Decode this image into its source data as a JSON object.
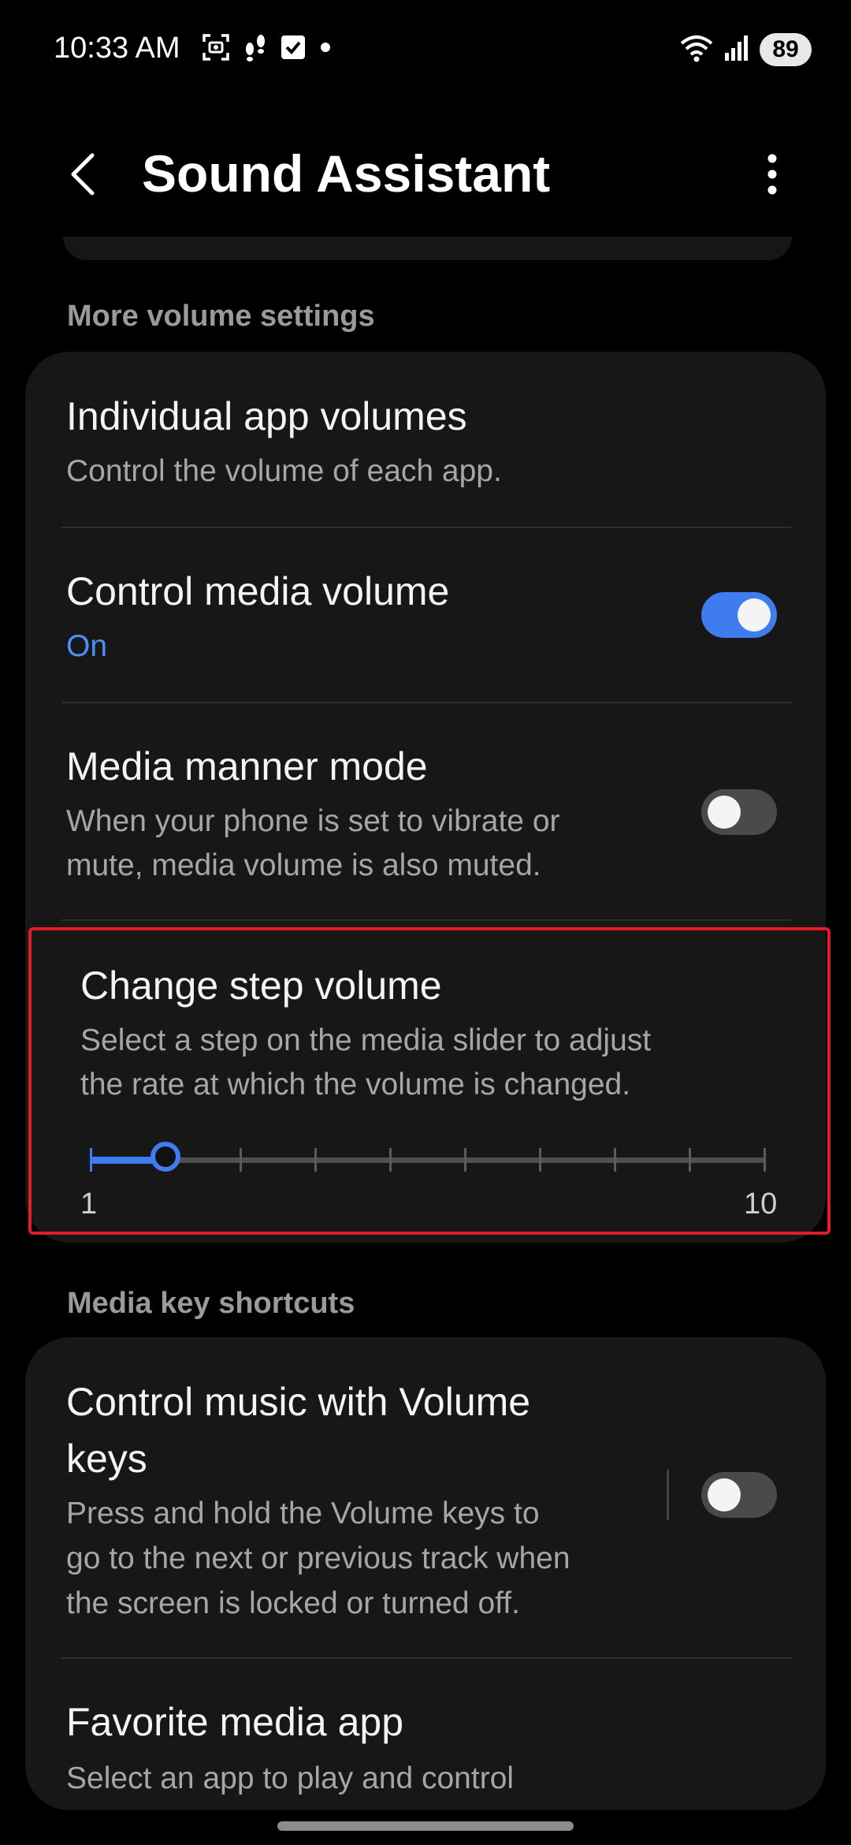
{
  "status_bar": {
    "time": "10:33 AM",
    "battery": "89"
  },
  "header": {
    "title": "Sound Assistant"
  },
  "sections": {
    "more_volume": {
      "label": "More volume settings",
      "individual_app_volumes": {
        "title": "Individual app volumes",
        "subtitle": "Control the volume of each app."
      },
      "control_media_volume": {
        "title": "Control media volume",
        "subtitle": "On",
        "enabled": true
      },
      "media_manner_mode": {
        "title": "Media manner mode",
        "subtitle_line1": "When your phone is set to vibrate or",
        "subtitle_line2": "mute, media volume is also muted.",
        "enabled": false
      },
      "change_step_volume": {
        "title": "Change step volume",
        "subtitle_line1": "Select a step on the media slider to adjust",
        "subtitle_line2": "the rate at which the volume is changed.",
        "min_label": "1",
        "max_label": "10",
        "min": 1,
        "max": 10,
        "value": 2
      }
    },
    "media_key_shortcuts": {
      "label": "Media key shortcuts",
      "control_music_volume_keys": {
        "title_line1": "Control music with Volume",
        "title_line2": "keys",
        "subtitle_line1": "Press and hold the Volume keys to",
        "subtitle_line2": "go to the next or previous track when",
        "subtitle_line3": "the screen is locked or turned off.",
        "enabled": false
      },
      "favorite_media_app": {
        "title": "Favorite media app",
        "subtitle_line1": "Select an app to play and control"
      }
    }
  },
  "colors": {
    "accent": "#3e7cf0",
    "highlight": "#e01e26"
  }
}
